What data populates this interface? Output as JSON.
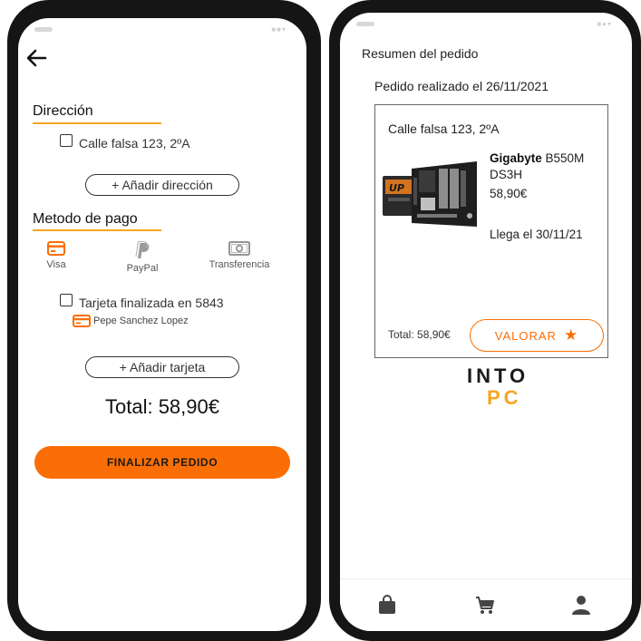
{
  "checkout": {
    "address_section": "Dirección",
    "address_option": "Calle falsa 123, 2ºA",
    "add_address": "+ Añadir dirección",
    "payment_section": "Metodo de pago",
    "payment_methods": [
      {
        "label": "Visa",
        "icon": "credit-card-icon"
      },
      {
        "label": "PayPal",
        "icon": "paypal-icon"
      },
      {
        "label": "Transferencia",
        "icon": "banknote-icon"
      }
    ],
    "card_option": "Tarjeta finalizada en 5843",
    "card_holder": "Pepe Sanchez Lopez",
    "add_card": "+ Añadir tarjeta",
    "total": "Total: 58,90€",
    "finish_button": "FINALIZAR PEDIDO"
  },
  "summary": {
    "title": "Resumen del pedido",
    "order_date": "Pedido realizado el 26/11/2021",
    "address": "Calle falsa 123, 2ºA",
    "product_brand": "Gigabyte",
    "product_model": "B550M DS3H",
    "product_price": "58,90€",
    "delivery": "Llega el 30/11/21",
    "total": "Total: 58,90€",
    "rate_button": "VALORAR",
    "logo_top": "INTO",
    "logo_bottom": "PC",
    "nav_items": [
      "bag-icon",
      "cart-icon",
      "user-icon"
    ]
  },
  "colors": {
    "accent": "#fb6e05",
    "underline": "#f5a623",
    "phone_frame": "#151515"
  }
}
